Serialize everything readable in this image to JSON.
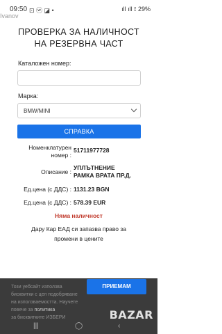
{
  "status_bar": {
    "time": "09:50",
    "left_icons": "⊡ ⓦ ◪ •",
    "right_text": "ıll ıll ⟟ 29%",
    "watermark": "Ivanov"
  },
  "page": {
    "heading_line1": "ПРОВЕРКА ЗА НАЛИЧНОСТ",
    "heading_line2": "НА РЕЗЕРВНА ЧАСТ"
  },
  "form": {
    "catalog_label": "Каталожен номер:",
    "catalog_value": "",
    "brand_label": "Марка:",
    "brand_selected": "BMW/MINI",
    "submit_label": "СПРАВКА"
  },
  "result": {
    "nomenclature_label_line1": "Номенклатурен",
    "nomenclature_label_line2": "номер :",
    "nomenclature_value": "51711977728",
    "description_label": "Описание :",
    "description_value_line1": "УПЛЪТНЕНИЕ",
    "description_value_line2": "РАМКА ВРАТА ПР.Д.",
    "price_bgn_label": "Ед.цена (с ДДС) :",
    "price_bgn_value": "1131.23 BGN",
    "price_eur_label": "Ед.цена (с ДДС) :",
    "price_eur_value": "578.39 EUR",
    "availability": "Няма наличност",
    "note_line1": "Дару Кар ЕАД си запазва право за",
    "note_line2": "промени в цените"
  },
  "cookie_banner": {
    "text_line1": "Този уебсайт използва",
    "text_line2": "бисквитки с цел подобряване",
    "text_line3": "на използваемостта. Научете",
    "text_line4_prefix": "повече за ",
    "text_link": "политика",
    "text_line5": "за бисквитките ИЗБЕРИ",
    "accept_label": "ПРИЕМАМ",
    "watermark": "BAZAR"
  },
  "navbar": {
    "recent": "|||",
    "home": "◯",
    "back": "‹"
  },
  "colors": {
    "accent": "#1a73e8",
    "availability": "#c0392b",
    "cookie_bg": "#3b3b3b"
  }
}
